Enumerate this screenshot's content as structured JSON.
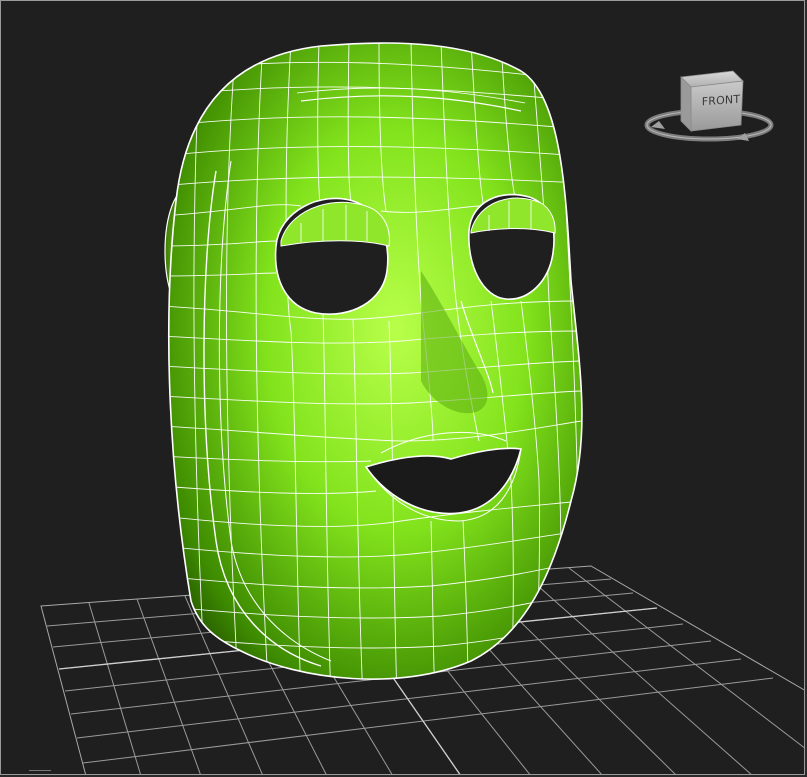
{
  "viewport": {
    "viewcube": {
      "face_label": "FRONT",
      "icon": "viewcube-icon"
    }
  },
  "model": {
    "color": "#7ee01a",
    "wire_color": "#ffffff"
  },
  "colors": {
    "background": "#1f1f1f",
    "grid": "#9a9a9a",
    "border": "#9a9a9a"
  }
}
